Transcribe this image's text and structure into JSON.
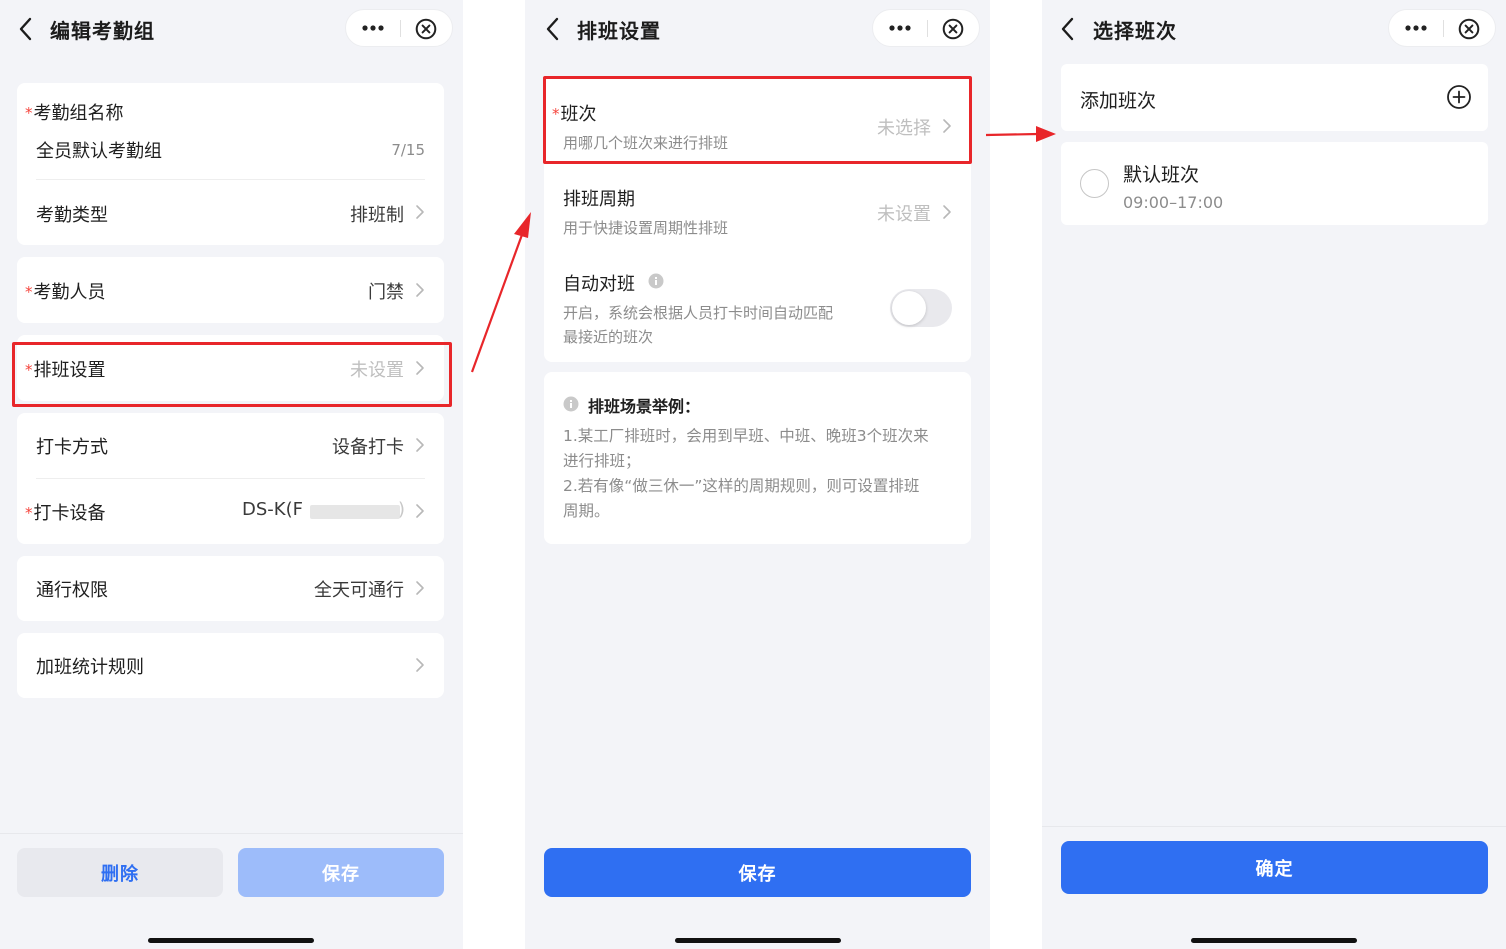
{
  "screen1": {
    "title": "编辑考勤组",
    "group_name_label": "考勤组名称",
    "group_name_value": "全员默认考勤组",
    "group_name_count": "7/15",
    "type_label": "考勤类型",
    "type_value": "排班制",
    "members_label": "考勤人员",
    "members_value": "门禁",
    "schedule_label": "排班设置",
    "schedule_value": "未设置",
    "punch_method_label": "打卡方式",
    "punch_method_value": "设备打卡",
    "punch_device_label": "打卡设备",
    "punch_device_value": "DS-K(F",
    "punch_device_value_end": ")",
    "access_label": "通行权限",
    "access_value": "全天可通行",
    "overtime_label": "加班统计规则",
    "delete_button": "删除",
    "save_button": "保存"
  },
  "screen2": {
    "title": "排班设置",
    "shift_label": "班次",
    "shift_desc": "用哪几个班次来进行排班",
    "shift_value": "未选择",
    "cycle_label": "排班周期",
    "cycle_desc": "用于快捷设置周期性排班",
    "cycle_value": "未设置",
    "auto_label": "自动对班",
    "auto_desc_line1": "开启，系统会根据人员打卡时间自动匹配",
    "auto_desc_line2": "最接近的班次",
    "auto_enabled": false,
    "example_title": "排班场景举例：",
    "example_line1": "1.某工厂排班时，会用到早班、中班、晚班3个班次来",
    "example_line2": "进行排班；",
    "example_line3": "2.若有像“做三休一”这样的周期规则，则可设置排班",
    "example_line4": "周期。",
    "save_button": "保存"
  },
  "screen3": {
    "title": "选择班次",
    "add_label": "添加班次",
    "shift_name": "默认班次",
    "shift_time": "09:00–17:00",
    "confirm_button": "确定"
  },
  "colors": {
    "accent": "#2f6ff2",
    "accent_disabled": "#9dbcfa",
    "highlight": "#e8262a",
    "required_star": "#f5453d",
    "background": "#f3f4f8"
  }
}
